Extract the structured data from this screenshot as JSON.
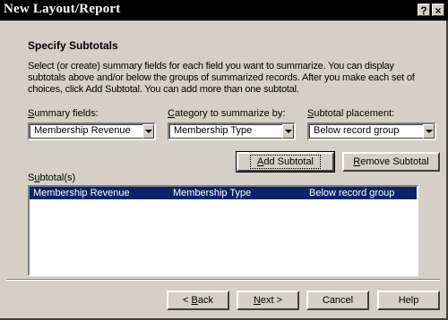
{
  "window": {
    "title": "New Layout/Report",
    "help_glyph": "?",
    "close_glyph": "×"
  },
  "page": {
    "heading": "Specify Subtotals",
    "intro": "Select (or create) summary fields for each field you want to summarize. You can display subtotals above and/or below the groups of summarized records. After you make each set of choices, click Add Subtotal. You can add more than one subtotal."
  },
  "fields": {
    "summary_label_key": "S",
    "summary_label_rest": "ummary fields:",
    "summary_value": "Membership Revenue",
    "category_label_key": "C",
    "category_label_rest": "ategory to summarize by:",
    "category_value": "Membership Type",
    "placement_label_key": "S",
    "placement_label_rest": "ubtotal placement:",
    "placement_value": "Below record group"
  },
  "actions": {
    "add_key": "A",
    "add_rest": "dd Subtotal",
    "remove_key": "R",
    "remove_rest": "emove Subtotal"
  },
  "subtotals": {
    "label_pre": "S",
    "label_key": "u",
    "label_rest": "btotal(s)",
    "rows": [
      {
        "field": "Membership Revenue",
        "category": "Membership Type",
        "placement": "Below record group"
      }
    ]
  },
  "footer": {
    "back_prefix": "< ",
    "back_key": "B",
    "back_rest": "ack",
    "next_key": "N",
    "next_rest": "ext >",
    "cancel": "Cancel",
    "help": "Help"
  },
  "colors": {
    "face": "#d4d0c8",
    "selection": "#0a246a",
    "titlebar": "#000000"
  }
}
